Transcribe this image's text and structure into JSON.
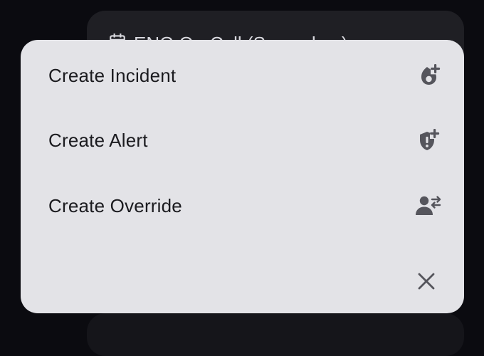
{
  "background_card": {
    "title": "ENG On-Call (Secondary)"
  },
  "menu": {
    "items": [
      {
        "label": "Create Incident",
        "icon": "incident-add-icon"
      },
      {
        "label": "Create Alert",
        "icon": "alert-shield-add-icon"
      },
      {
        "label": "Create Override",
        "icon": "person-swap-icon"
      }
    ],
    "close_icon": "close-icon"
  },
  "colors": {
    "sheet_bg": "#e3e3e7",
    "text": "#1b1b1f",
    "icon": "#55555c",
    "backdrop": "#0b0b10"
  }
}
